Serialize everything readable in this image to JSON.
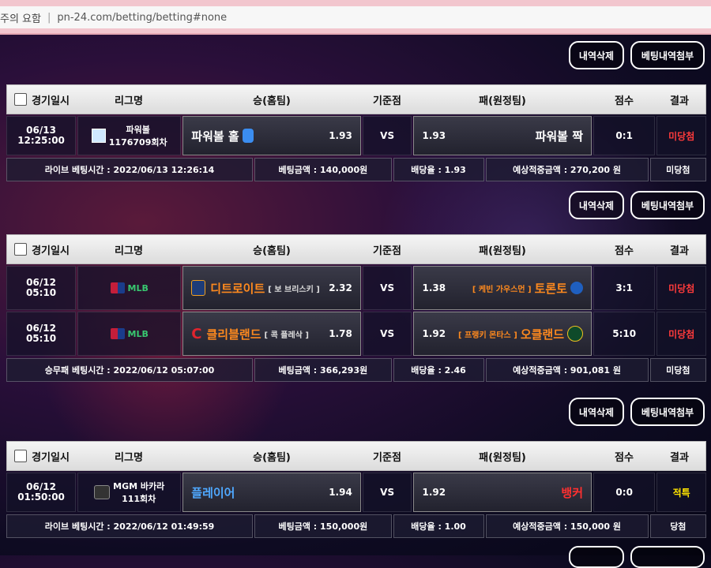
{
  "address_bar": {
    "site_title": "주의 요함",
    "url": "pn-24.com/betting/betting#none"
  },
  "actions": {
    "delete_label": "내역삭제",
    "attach_label": "베팅내역첨부"
  },
  "header": {
    "date": "경기일시",
    "league": "리그명",
    "home": "승(홈팀)",
    "base": "기준점",
    "away": "패(원정팀)",
    "score": "점수",
    "result": "결과"
  },
  "bets": [
    {
      "rows": [
        {
          "date": "06/13",
          "time": "12:25:00",
          "league_line1": "파워볼",
          "league_line2": "1176709회차",
          "home_team": "파워볼 홀",
          "home_odds": "1.93",
          "vs": "VS",
          "away_odds": "1.93",
          "away_team": "파워볼 짝",
          "score": "0:1",
          "result": "미당첨"
        }
      ],
      "summary": {
        "time": "라이브 베팅시간 : 2022/06/13 12:26:14",
        "amount": "베팅금액 : 140,000원",
        "rate": "배당율 : 1.93",
        "expected": "예상적중금액 : 270,200 원",
        "status": "미당첨"
      }
    },
    {
      "rows": [
        {
          "date": "06/12",
          "time": "05:10",
          "league_line1": "MLB",
          "home_team": "디트로이트",
          "home_pitcher": "[ 보 브리스키 ]",
          "home_odds": "2.32",
          "vs": "VS",
          "away_odds": "1.38",
          "away_pitcher": "[ 케빈 가우스먼 ]",
          "away_team": "토론토",
          "score": "3:1",
          "result": "미당첨"
        },
        {
          "date": "06/12",
          "time": "05:10",
          "league_line1": "MLB",
          "home_team": "클리블랜드",
          "home_pitcher": "[ 콕 플레삭 ]",
          "home_odds": "1.78",
          "vs": "VS",
          "away_odds": "1.92",
          "away_pitcher": "[ 프랭키 몬타스 ]",
          "away_team": "오클랜드",
          "score": "5:10",
          "result": "미당첨"
        }
      ],
      "summary": {
        "time": "승무패 베팅시간 : 2022/06/12 05:07:00",
        "amount": "베팅금액 : 366,293원",
        "rate": "배당율 : 2.46",
        "expected": "예상적중금액 : 901,081 원",
        "status": "미당첨"
      }
    },
    {
      "rows": [
        {
          "date": "06/12",
          "time": "01:50:00",
          "league_line1": "MGM 바카라",
          "league_line2": "111회차",
          "home_team": "플레이어",
          "home_odds": "1.94",
          "vs": "VS",
          "away_odds": "1.92",
          "away_team": "뱅커",
          "score": "0:0",
          "result": "적특"
        }
      ],
      "summary": {
        "time": "라이브 베팅시간 : 2022/06/12 01:49:59",
        "amount": "베팅금액 : 150,000원",
        "rate": "배당율 : 1.00",
        "expected": "예상적중금액 : 150,000 원",
        "status": "당첨"
      }
    }
  ],
  "colors": {
    "miss": "#ff3b3b",
    "special": "#ffe400",
    "header_bg": "#e8e8e8",
    "address_bar": "#f2c6ce"
  }
}
